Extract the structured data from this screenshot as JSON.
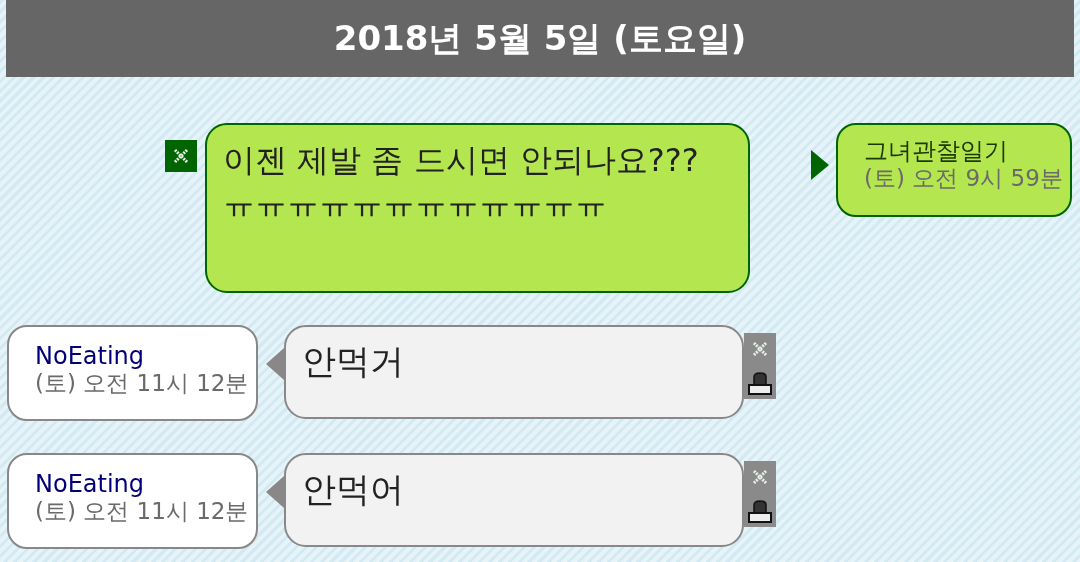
{
  "date_header": "2018년 5월 5일 (토요일)",
  "messages": [
    {
      "kind": "mine",
      "text": "이젠 제발 좀 드시면 안되나요???ㅠㅠㅠㅠㅠㅠㅠㅠㅠㅠㅠㅠ",
      "sender": "그녀관찰일기",
      "time": "(토) 오전 9시 59분"
    },
    {
      "kind": "other",
      "text": "안먹거",
      "sender": "NoEating",
      "time": "(토) 오전 11시 12분"
    },
    {
      "kind": "other",
      "text": "안먹어",
      "sender": "NoEating",
      "time": "(토) 오전 11시 12분"
    }
  ]
}
